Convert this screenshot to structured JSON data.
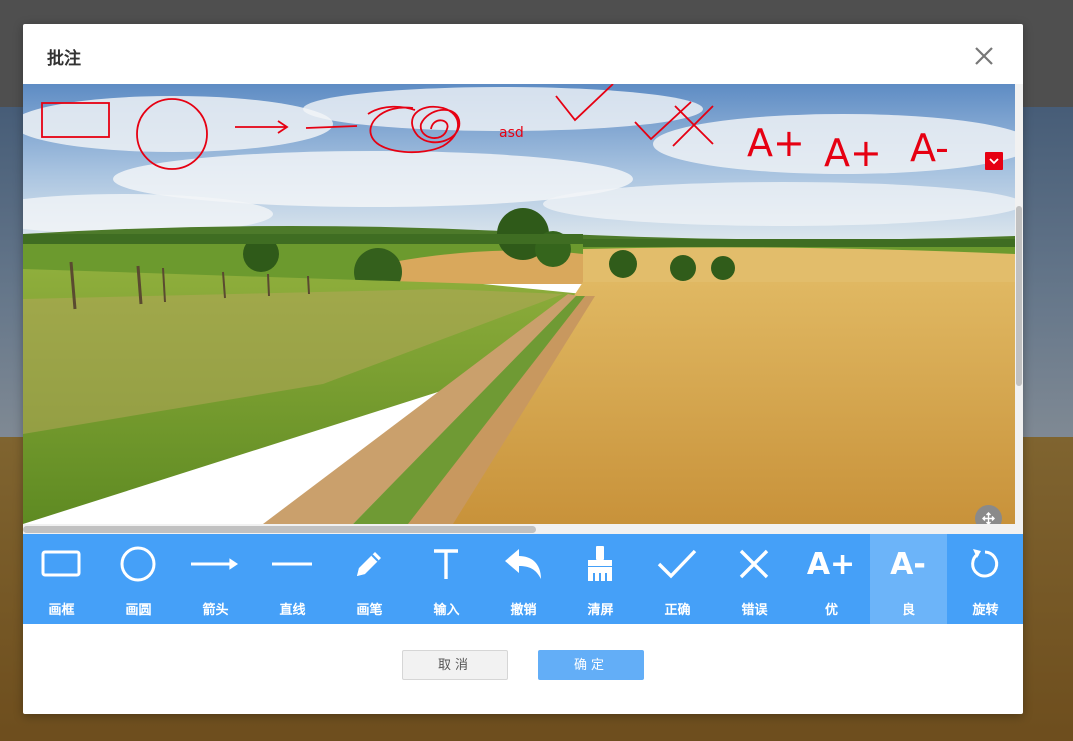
{
  "modal": {
    "title": "批注"
  },
  "annotations": {
    "text": "asd",
    "grade_a_plus_1": "A+",
    "grade_a_plus_2": "A+",
    "grade_a_minus": "A-"
  },
  "toolbar": {
    "items": [
      {
        "label": "画框",
        "icon": "rectangle-icon"
      },
      {
        "label": "画圆",
        "icon": "circle-icon"
      },
      {
        "label": "箭头",
        "icon": "arrow-icon"
      },
      {
        "label": "直线",
        "icon": "line-icon"
      },
      {
        "label": "画笔",
        "icon": "pencil-icon"
      },
      {
        "label": "输入",
        "icon": "text-icon"
      },
      {
        "label": "撤销",
        "icon": "undo-icon"
      },
      {
        "label": "清屏",
        "icon": "brush-icon"
      },
      {
        "label": "正确",
        "icon": "check-icon"
      },
      {
        "label": "错误",
        "icon": "cross-icon"
      },
      {
        "label": "优",
        "icon": "a-plus-icon"
      },
      {
        "label": "良",
        "icon": "a-minus-icon",
        "active": true
      },
      {
        "label": "旋转",
        "icon": "rotate-icon"
      }
    ],
    "icon_text_plus": "A+",
    "icon_text_minus": "A-"
  },
  "footer": {
    "cancel_label": "取消",
    "confirm_label": "确定"
  },
  "colors": {
    "toolbar_bg": "#45a0f8",
    "toolbar_active": "#6cb4f9",
    "annotation_red": "#e60012",
    "confirm_button": "#63aef7"
  }
}
